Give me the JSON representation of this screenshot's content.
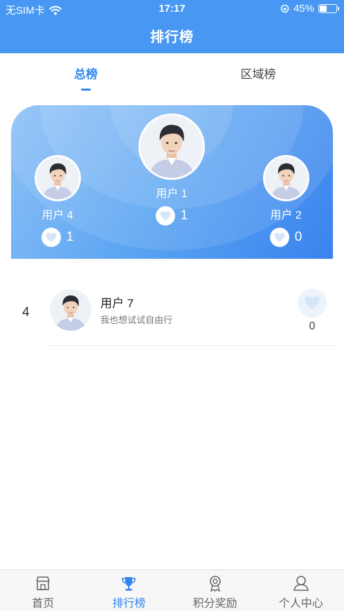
{
  "status": {
    "carrier": "无SIM卡",
    "time": "17:17",
    "battery": "45%",
    "battery_level": 0.45
  },
  "nav": {
    "title": "排行榜"
  },
  "tabs": [
    {
      "label": "总榜",
      "active": true
    },
    {
      "label": "区域榜",
      "active": false
    }
  ],
  "podium": {
    "first": {
      "name": "用户 1",
      "likes": "1"
    },
    "second": {
      "name": "用户 2",
      "likes": "0"
    },
    "third": {
      "name": "用户 4",
      "likes": "1"
    }
  },
  "list": [
    {
      "rank": "4",
      "name": "用户 7",
      "motto": "我也想试试自由行",
      "likes": "0"
    }
  ],
  "tabbar": [
    {
      "label": "首页",
      "icon": "store-icon",
      "active": false
    },
    {
      "label": "排行榜",
      "icon": "trophy-icon",
      "active": true
    },
    {
      "label": "积分奖励",
      "icon": "medal-icon",
      "active": false
    },
    {
      "label": "个人中心",
      "icon": "user-icon",
      "active": false
    }
  ],
  "colors": {
    "primary": "#4797f3",
    "accent": "#2f86ef"
  }
}
